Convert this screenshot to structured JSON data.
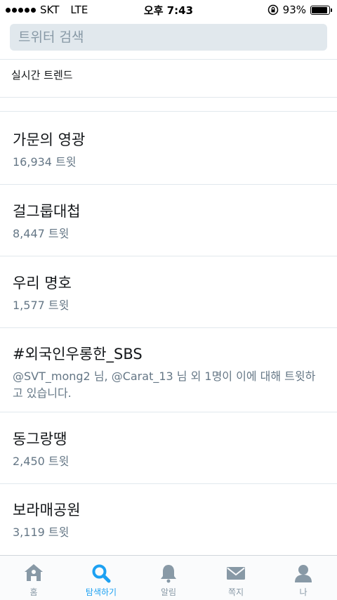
{
  "status_bar": {
    "carrier": "SKT",
    "network": "LTE",
    "time": "오후 7:43",
    "battery_percent": "93%",
    "battery_level": 0.93
  },
  "search": {
    "placeholder": "트위터 검색"
  },
  "section": {
    "title": "실시간 트렌드"
  },
  "trends": [
    {
      "name": "가문의 영광",
      "meta": "16,934 트윗"
    },
    {
      "name": "걸그룹대첩",
      "meta": "8,447 트윗"
    },
    {
      "name": "우리 명호",
      "meta": "1,577 트윗"
    },
    {
      "name": "#외국인우롱한_SBS",
      "meta": "@SVT_mong2 님, @Carat_13 님 외 1명이 이에 대해 트윗하고 있습니다."
    },
    {
      "name": "동그랑땡",
      "meta": "2,450 트윗"
    },
    {
      "name": "보라매공원",
      "meta": "3,119 트윗"
    }
  ],
  "tabs": [
    {
      "label": "홈",
      "icon": "home-icon",
      "active": false
    },
    {
      "label": "탐색하기",
      "icon": "search-icon",
      "active": true
    },
    {
      "label": "알림",
      "icon": "bell-icon",
      "active": false
    },
    {
      "label": "쪽지",
      "icon": "envelope-icon",
      "active": false
    },
    {
      "label": "나",
      "icon": "person-icon",
      "active": false
    }
  ],
  "colors": {
    "accent": "#1da1f2",
    "inactive_tab": "#8899a6",
    "meta_text": "#657786",
    "search_bg": "#e1e8ed"
  }
}
